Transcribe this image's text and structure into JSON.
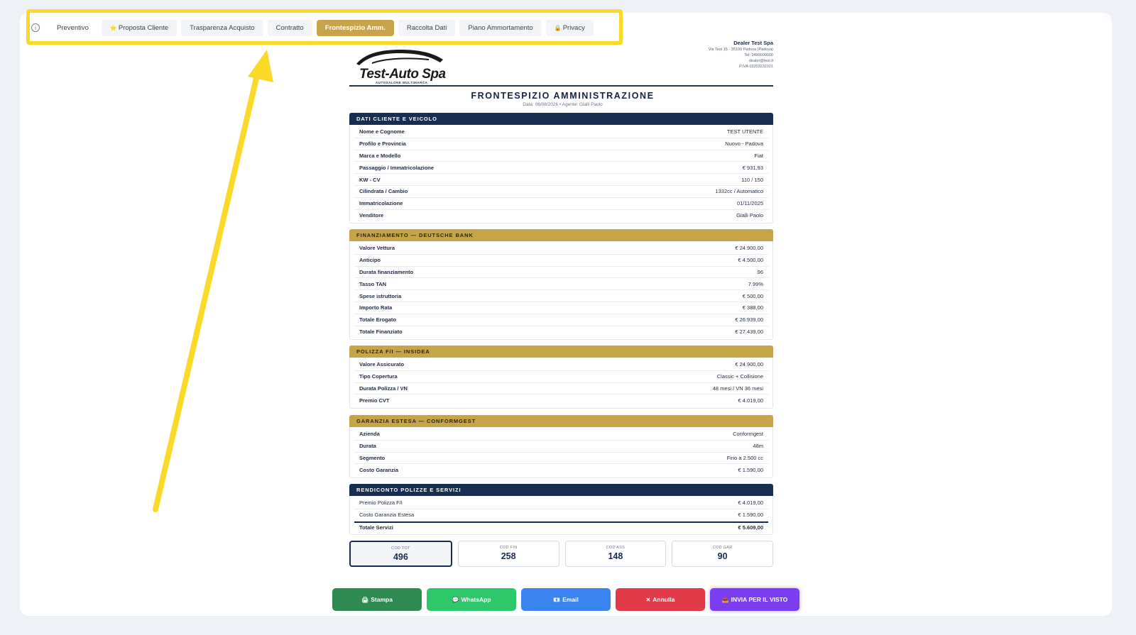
{
  "tabs": [
    {
      "label": "Preventivo",
      "icon": ""
    },
    {
      "label": "Proposta Cliente",
      "icon": "⭐"
    },
    {
      "label": "Trasparenza Acquisto",
      "icon": ""
    },
    {
      "label": "Contratto",
      "icon": ""
    },
    {
      "label": "Frontespizio Amm.",
      "icon": "",
      "active": true
    },
    {
      "label": "Raccolta Dati",
      "icon": ""
    },
    {
      "label": "Piano Ammortamento",
      "icon": ""
    },
    {
      "label": "Privacy",
      "icon": "🔒"
    }
  ],
  "info_icon": "i",
  "logo": {
    "text": "Test-Auto Spa",
    "sub": "AUTOSALONE MULTIMARCA"
  },
  "dealer": {
    "name": "Dealer Test Spa",
    "address": "Via Test 15 - 35100 Padova (Padova)",
    "tel": "Tel: 3490000000",
    "email": "dealer@test.it",
    "piva": "P.IVA 03203232321"
  },
  "document": {
    "title": "FRONTESPIZIO AMMINISTRAZIONE",
    "subtitle": "Data: 06/08/2026 • Agente: Gialli Paolo"
  },
  "sections": {
    "cliente": {
      "title": "DATI CLIENTE E VEICOLO",
      "rows": [
        {
          "k": "Nome e Cognome",
          "v": "TEST UTENTE"
        },
        {
          "k": "Profilo e Provincia",
          "v": "Nuovo - Padova"
        },
        {
          "k": "Marca e Modello",
          "v": "Fiat"
        },
        {
          "k": "Passaggio / Immatricolazione",
          "v": "€ 931,93"
        },
        {
          "k": "KW - CV",
          "v": "110 / 150"
        },
        {
          "k": "Cilindrata / Cambio",
          "v": "1332cc / Automatico"
        },
        {
          "k": "Immatricolazione",
          "v": "01/11/2025"
        },
        {
          "k": "Venditore",
          "v": "Gialli Paolo"
        }
      ]
    },
    "finanziamento": {
      "title": "FINANZIAMENTO — DEUTSCHE BANK",
      "rows": [
        {
          "k": "Valore Vettura",
          "v": "€ 24.900,00"
        },
        {
          "k": "Anticipo",
          "v": "€ 4.500,00"
        },
        {
          "k": "Durata finanziamento",
          "v": "96"
        },
        {
          "k": "Tasso TAN",
          "v": "7.99%"
        },
        {
          "k": "Spese istruttoria",
          "v": "€ 500,00"
        },
        {
          "k": "Importo Rata",
          "v": "€ 388,00"
        },
        {
          "k": "Totale Erogato",
          "v": "€ 26.939,00"
        },
        {
          "k": "Totale Finanziato",
          "v": "€ 27.439,00"
        }
      ]
    },
    "polizza": {
      "title": "POLIZZA F/I — INSIDEA",
      "rows": [
        {
          "k": "Valore Assicurato",
          "v": "€ 24.900,00"
        },
        {
          "k": "Tipo Copertura",
          "v": "Classic + Collisione"
        },
        {
          "k": "Durata Polizza / VN",
          "v": "48 mesi / VN 36 mesi"
        },
        {
          "k": "Premio CVT",
          "v": "€ 4.019,00"
        }
      ]
    },
    "garanzia": {
      "title": "GARANZIA ESTESA — CONFORMGEST",
      "rows": [
        {
          "k": "Azienda",
          "v": "Conformgest"
        },
        {
          "k": "Durata",
          "v": "48m"
        },
        {
          "k": "Segmento",
          "v": "Fino a 2.500 cc"
        },
        {
          "k": "Costo Garanzia",
          "v": "€ 1.590,00"
        }
      ]
    },
    "rendiconto": {
      "title": "RENDICONTO POLIZZE E SERVIZI",
      "rows": [
        {
          "k": "Premio Polizza F/I",
          "v": "€ 4.019,00"
        },
        {
          "k": "Costo Garanzia Estesa",
          "v": "€ 1.590,00"
        }
      ],
      "total": {
        "k": "Totale Servizi",
        "v": "€ 5.609,00"
      }
    }
  },
  "codes": [
    {
      "label": "COD TOT",
      "value": "496",
      "active": true
    },
    {
      "label": "COD FIN",
      "value": "258"
    },
    {
      "label": "COD ASS",
      "value": "148"
    },
    {
      "label": "COD GAR",
      "value": "90"
    }
  ],
  "actions": [
    {
      "label": "Stampa",
      "icon": "🖨",
      "color": "#2e8b4f"
    },
    {
      "label": "WhatsApp",
      "icon": "💬",
      "color": "#2ec86b"
    },
    {
      "label": "Email",
      "icon": "📧",
      "color": "#3b84f0"
    },
    {
      "label": "Annulla",
      "icon": "✕",
      "color": "#e13a48"
    },
    {
      "label": "INVIA PER IL VISTO",
      "icon": "📤",
      "color": "#7b3df0"
    }
  ],
  "colors": {
    "highlight": "#fbd928",
    "navy": "#172d52",
    "gold": "#c5a44b"
  }
}
